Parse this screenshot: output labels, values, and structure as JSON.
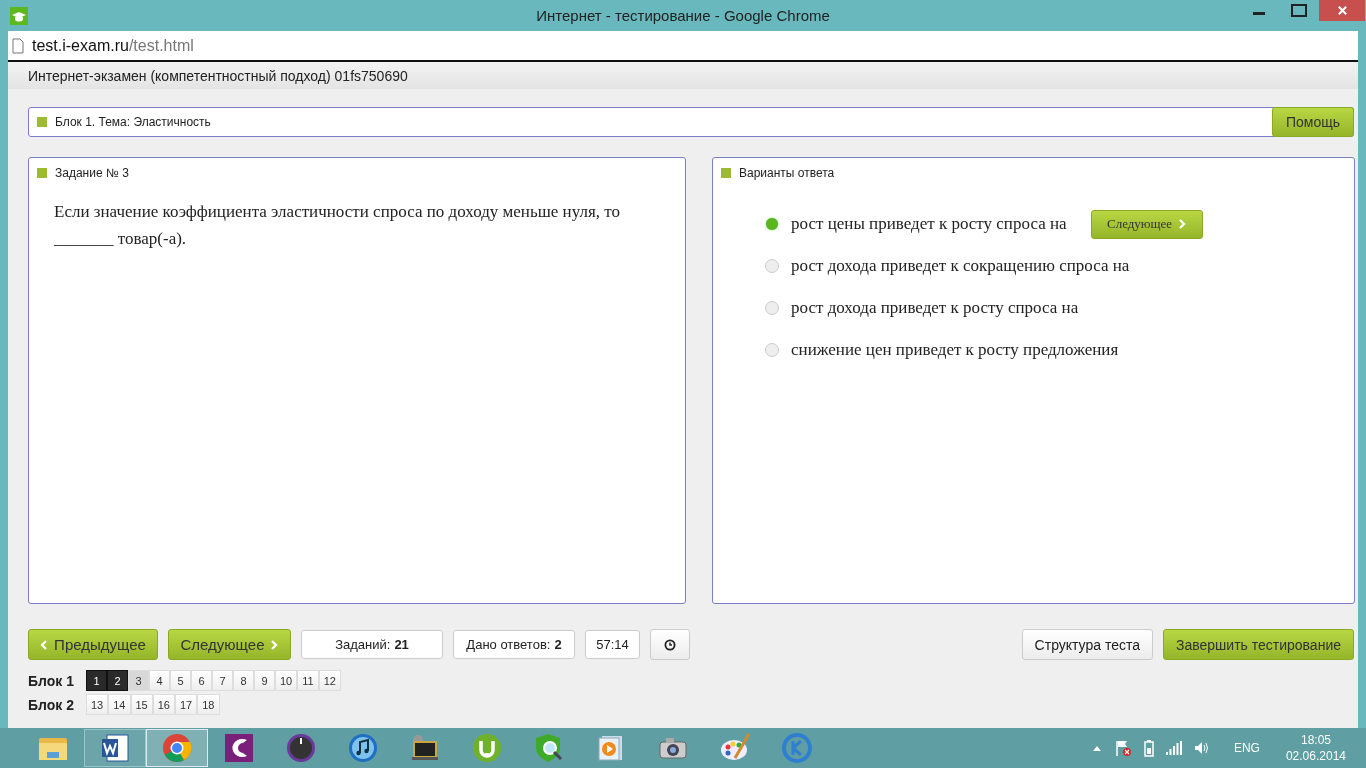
{
  "window": {
    "title": "Интернет - тестирование - Google Chrome"
  },
  "address_bar": {
    "host": "test.i-exam.ru",
    "path": "/test.html"
  },
  "header": "Интернет-экзамен (компетентностный подход) 01fs750690",
  "topic": {
    "title": "Блок 1. Тема: Эластичность",
    "help_button": "Помощь"
  },
  "task": {
    "title": "Задание № 3",
    "question": "Если значение коэффициента эластичности спроса по доходу меньше нуля, то _______ товар(-а)."
  },
  "answers": {
    "title": "Варианты ответа",
    "next_button": "Следующее",
    "options": [
      {
        "label": "рост цены приведет к росту спроса на",
        "selected": true
      },
      {
        "label": "рост дохода приведет к сокращению спроса на",
        "selected": false
      },
      {
        "label": "рост дохода приведет к росту спроса на",
        "selected": false
      },
      {
        "label": "снижение цен приведет к росту предложения",
        "selected": false
      }
    ]
  },
  "nav": {
    "prev_button": "Предыдущее",
    "next_button": "Следующее",
    "tasks_label": "Заданий:",
    "tasks_value": "21",
    "answered_label": "Дано ответов:",
    "answered_value": "2",
    "timer": "57:14",
    "structure_button": "Структура теста",
    "finish_button": "Завершить тестирование"
  },
  "blocks": [
    {
      "label": "Блок 1",
      "groups": [
        [
          {
            "label": "1",
            "answered": true,
            "selected": false
          },
          {
            "label": "2",
            "answered": true,
            "selected": false
          },
          {
            "label": "3",
            "answered": false,
            "selected": true
          },
          {
            "label": "4",
            "answered": false,
            "selected": false
          },
          {
            "label": "5",
            "answered": false,
            "selected": false
          },
          {
            "label": "6",
            "answered": false,
            "selected": false
          },
          {
            "label": "7",
            "answered": false,
            "selected": false
          },
          {
            "label": "8",
            "answered": false,
            "selected": false
          },
          {
            "label": "9",
            "answered": false,
            "selected": false
          },
          {
            "label": "10",
            "answered": false,
            "selected": false
          },
          {
            "label": "11",
            "answered": false,
            "selected": false
          },
          {
            "label": "12",
            "answered": false,
            "selected": false
          }
        ]
      ]
    },
    {
      "label": "Блок 2",
      "groups": [
        [
          {
            "label": "13",
            "answered": false,
            "selected": false
          },
          {
            "label": "14",
            "answered": false,
            "selected": false
          },
          {
            "label": "15",
            "answered": false,
            "selected": false
          },
          {
            "label": "16",
            "answered": false,
            "selected": false
          },
          {
            "label": "17",
            "answered": false,
            "selected": false
          },
          {
            "label": "18",
            "answered": false,
            "selected": false
          }
        ]
      ]
    }
  ],
  "taskbar": {
    "apps": [
      {
        "kind": "folder",
        "open": false,
        "selected": false
      },
      {
        "kind": "word",
        "open": true,
        "selected": false
      },
      {
        "kind": "chrome",
        "open": true,
        "selected": true
      },
      {
        "kind": "letter-app",
        "open": false,
        "selected": false
      },
      {
        "kind": "dial",
        "open": false,
        "selected": false
      },
      {
        "kind": "music",
        "open": false,
        "selected": false
      },
      {
        "kind": "film",
        "open": false,
        "selected": false
      },
      {
        "kind": "torrent",
        "open": false,
        "selected": false
      },
      {
        "kind": "shield",
        "open": false,
        "selected": false
      },
      {
        "kind": "player",
        "open": false,
        "selected": false
      },
      {
        "kind": "camera",
        "open": false,
        "selected": false
      },
      {
        "kind": "palette",
        "open": false,
        "selected": false
      },
      {
        "kind": "ring",
        "open": false,
        "selected": false
      }
    ],
    "language": "ENG",
    "time": "18:05",
    "date": "02.06.2014"
  }
}
